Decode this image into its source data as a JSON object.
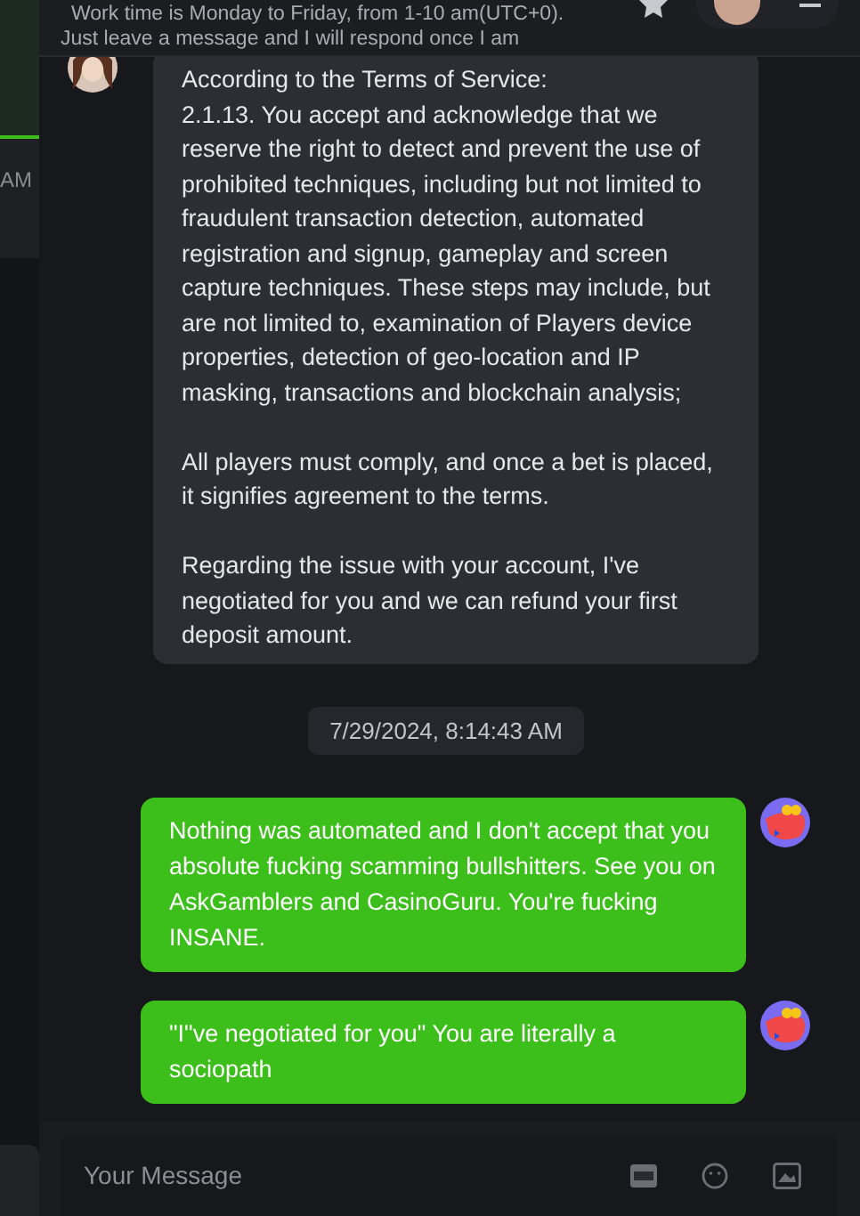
{
  "sidebar": {
    "time_fragment": "AM"
  },
  "header": {
    "lines": [
      "Work time is Monday to Friday, from 1-10 am(UTC+0).",
      "Just leave a message and I will respond once I am"
    ]
  },
  "messages": [
    {
      "kind": "incoming",
      "paragraphs": [
        "According to the Terms of Service:\n2.1.13. You accept and acknowledge that we reserve the right to detect and prevent the use of prohibited techniques, including but not limited to fraudulent transaction detection, automated registration and signup, gameplay and screen capture techniques. These steps may include, but are not limited to, examination of Players device properties, detection of geo-location and IP masking, transactions and blockchain analysis;",
        "All players must comply, and once a bet is placed, it signifies agreement to the terms.",
        "Regarding the issue with your account, I've negotiated for you and we can refund your first deposit amount."
      ]
    },
    {
      "kind": "timestamp",
      "text": "7/29/2024, 8:14:43 AM"
    },
    {
      "kind": "outgoing",
      "paragraphs": [
        "Nothing was automated and I don't accept that you absolute fucking scamming bullshitters. See you on AskGamblers and CasinoGuru. You're fucking INSANE."
      ]
    },
    {
      "kind": "outgoing",
      "paragraphs": [
        "\"I\"ve negotiated for you\" You are literally a sociopath"
      ]
    }
  ],
  "composer": {
    "placeholder": "Your Message"
  }
}
